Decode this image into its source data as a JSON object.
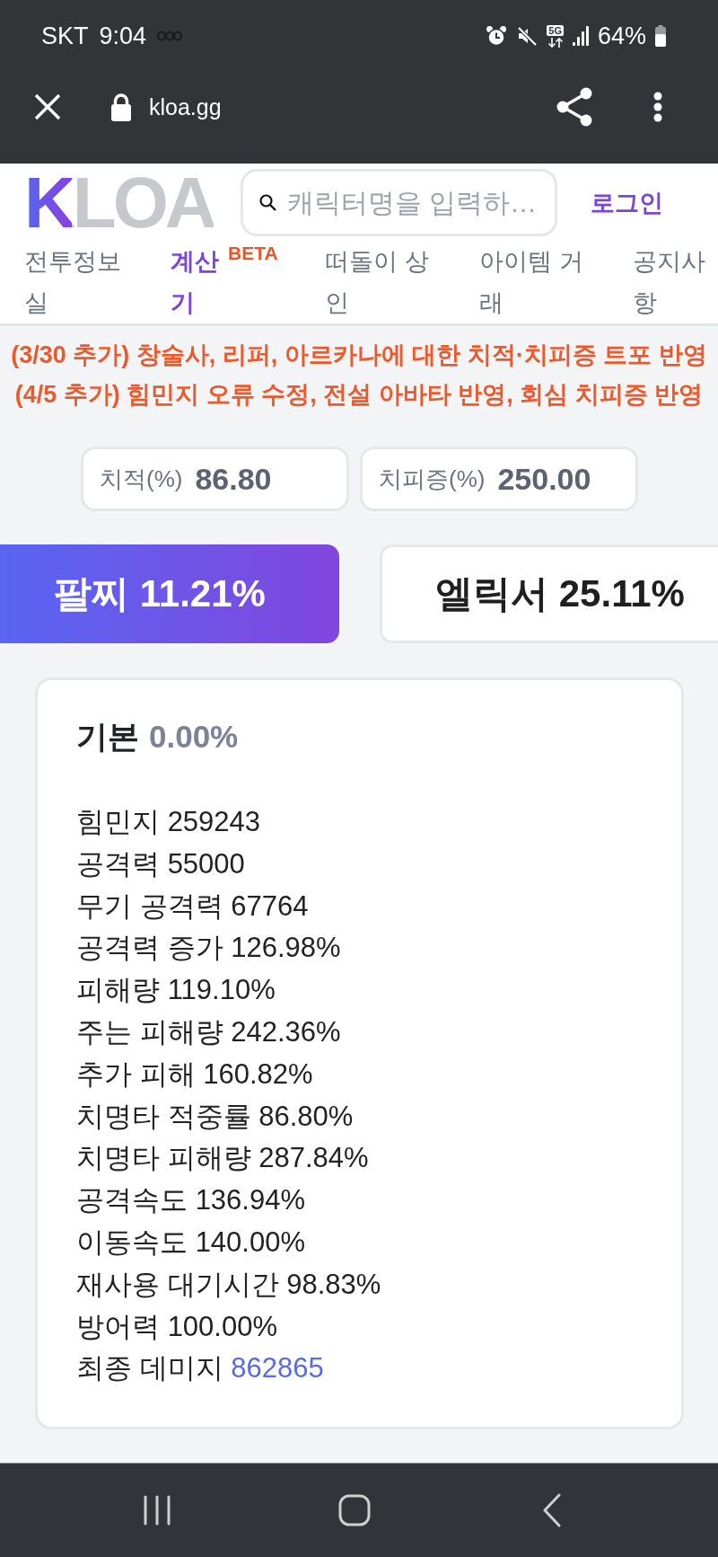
{
  "status_bar": {
    "carrier": "SKT",
    "time": "9:04",
    "network": "5G",
    "battery": "64%"
  },
  "browser_bar": {
    "url": "kloa.gg"
  },
  "header": {
    "logo": "KLOA",
    "search": {
      "placeholder": "캐릭터명을 입력하…"
    },
    "login": "로그인"
  },
  "nav": [
    {
      "label": "전투정보실",
      "selected": false
    },
    {
      "label": "계산기",
      "badge": "BETA",
      "selected": true
    },
    {
      "label": "떠돌이 상인",
      "selected": false
    },
    {
      "label": "아이템 거래",
      "selected": false
    },
    {
      "label": "공지사항",
      "selected": false
    }
  ],
  "notices": [
    "(3/30 추가) 창술사, 리퍼, 아르카나에 대한 치적·치피증 트포 반영",
    "(4/5 추가) 힘민지 오류 수정, 전설 아바타 반영, 회심 치피증 반영"
  ],
  "stat_inputs": [
    {
      "label": "치적(%)",
      "value": "86.80"
    },
    {
      "label": "치피증(%)",
      "value": "250.00"
    }
  ],
  "tabs": [
    {
      "label": "팔찌 11.21%",
      "selected": true
    },
    {
      "label": "엘릭서 25.11%",
      "selected": false
    }
  ],
  "result_card": {
    "title": "기본",
    "value": "0.00%",
    "stats": [
      {
        "label": "힘민지",
        "value": "259243",
        "kind": "stat"
      },
      {
        "label": "공격력",
        "value": "55000",
        "kind": "stat"
      },
      {
        "label": "무기 공격력",
        "value": "67764",
        "kind": "stat"
      },
      {
        "label": "공격력 증가",
        "value": "126.98%",
        "kind": "stat"
      },
      {
        "label": "피해량",
        "value": "119.10%",
        "kind": "stat"
      },
      {
        "label": "주는 피해량",
        "value": "242.36%",
        "kind": "stat"
      },
      {
        "label": "추가 피해",
        "value": "160.82%",
        "kind": "stat"
      },
      {
        "label": "치명타 적중률",
        "value": "86.80%",
        "kind": "stat"
      },
      {
        "label": "치명타 피해량",
        "value": "287.84%",
        "kind": "stat"
      },
      {
        "label": "공격속도",
        "value": "136.94%",
        "kind": "stat"
      },
      {
        "label": "이동속도",
        "value": "140.00%",
        "kind": "stat"
      },
      {
        "label": "재사용 대기시간",
        "value": "98.83%",
        "kind": "stat"
      },
      {
        "label": "방어력",
        "value": "100.00%",
        "kind": "stat"
      },
      {
        "label": "최종 데미지",
        "value": "862865",
        "kind": "total"
      }
    ]
  }
}
